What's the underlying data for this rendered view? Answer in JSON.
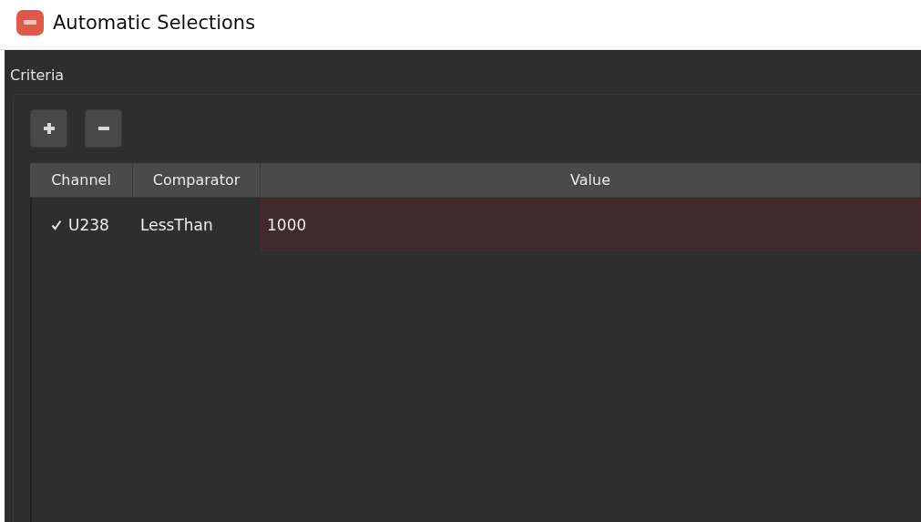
{
  "window": {
    "title": "Automatic Selections"
  },
  "group": {
    "title": "Criteria"
  },
  "toolbar": [
    {
      "kind": "add"
    },
    {
      "kind": "remove"
    }
  ],
  "table": {
    "columns": [
      "Channel",
      "Comparator",
      "Value"
    ],
    "rows": [
      {
        "checked": true,
        "channel": "U238",
        "comparator": "LessThan",
        "value": "1000"
      }
    ]
  }
}
